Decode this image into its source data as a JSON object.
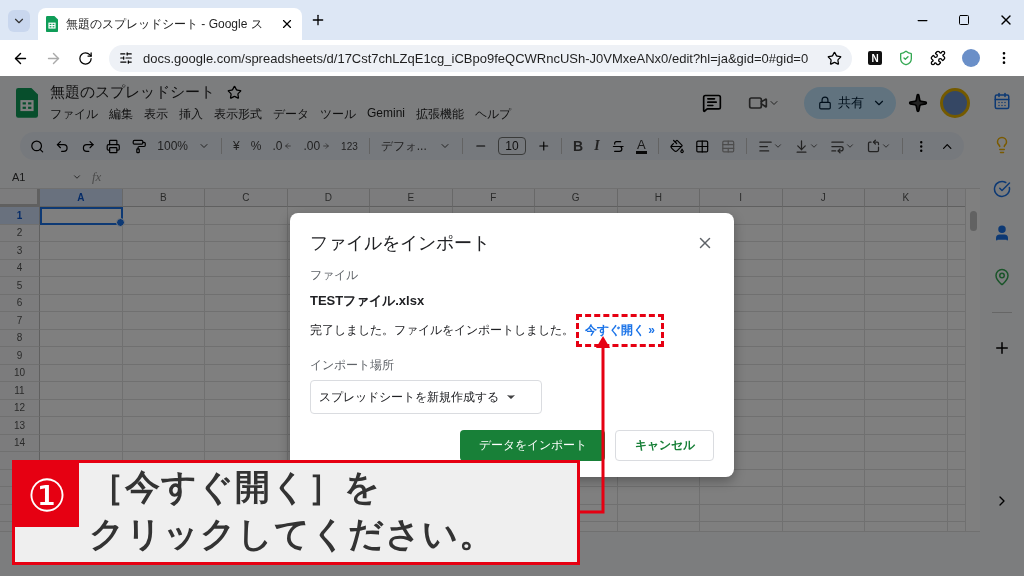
{
  "browser": {
    "tab_title": "無題のスプレッドシート - Google ス",
    "url": "docs.google.com/spreadsheets/d/17Cst7chLZqE1cg_iCBpo9feQCWRncUSh-J0VMxeANx0/edit?hl=ja&gid=0#gid=0",
    "extension_label": "N"
  },
  "sheets": {
    "title": "無題のスプレッドシート",
    "menu": [
      "ファイル",
      "編集",
      "表示",
      "挿入",
      "表示形式",
      "データ",
      "ツール",
      "Gemini",
      "拡張機能",
      "ヘルプ"
    ],
    "share_label": "共有",
    "toolbar": {
      "zoom": "100%",
      "currency": "¥",
      "percent": "%",
      "decrease_decimal": ".0",
      "increase_decimal": ".00",
      "number_format": "123",
      "font": "デフォ...",
      "font_size": "10",
      "bold": "B",
      "italic": "I",
      "text_color": "A"
    },
    "name_box": "A1",
    "formula_label": "fx",
    "columns": [
      {
        "label": "A",
        "selected": true
      },
      {
        "label": "B",
        "selected": false
      },
      {
        "label": "C",
        "selected": false
      },
      {
        "label": "D",
        "selected": false
      },
      {
        "label": "E",
        "selected": false
      },
      {
        "label": "F",
        "selected": false
      },
      {
        "label": "G",
        "selected": false
      },
      {
        "label": "H",
        "selected": false
      },
      {
        "label": "I",
        "selected": false
      },
      {
        "label": "J",
        "selected": false
      },
      {
        "label": "K",
        "selected": false
      }
    ],
    "rows": [
      {
        "label": "1",
        "selected": true
      },
      {
        "label": "2",
        "selected": false
      },
      {
        "label": "3",
        "selected": false
      },
      {
        "label": "4",
        "selected": false
      },
      {
        "label": "5",
        "selected": false
      },
      {
        "label": "6",
        "selected": false
      },
      {
        "label": "7",
        "selected": false
      },
      {
        "label": "8",
        "selected": false
      },
      {
        "label": "9",
        "selected": false
      },
      {
        "label": "10",
        "selected": false
      },
      {
        "label": "11",
        "selected": false
      },
      {
        "label": "12",
        "selected": false
      },
      {
        "label": "13",
        "selected": false
      },
      {
        "label": "14",
        "selected": false
      }
    ]
  },
  "dialog": {
    "title": "ファイルをインポート",
    "file_label": "ファイル",
    "file_name": "TESTファイル.xlsx",
    "message": "完了しました。ファイルをインポートしました。",
    "link": "今すぐ開く »",
    "location_label": "インポート場所",
    "location_value": "スプレッドシートを新規作成する",
    "primary_button": "データをインポート",
    "cancel_button": "キャンセル"
  },
  "annotation": {
    "badge": "①",
    "lines": [
      "［今すぐ開く］を",
      "クリックしてください。"
    ]
  }
}
